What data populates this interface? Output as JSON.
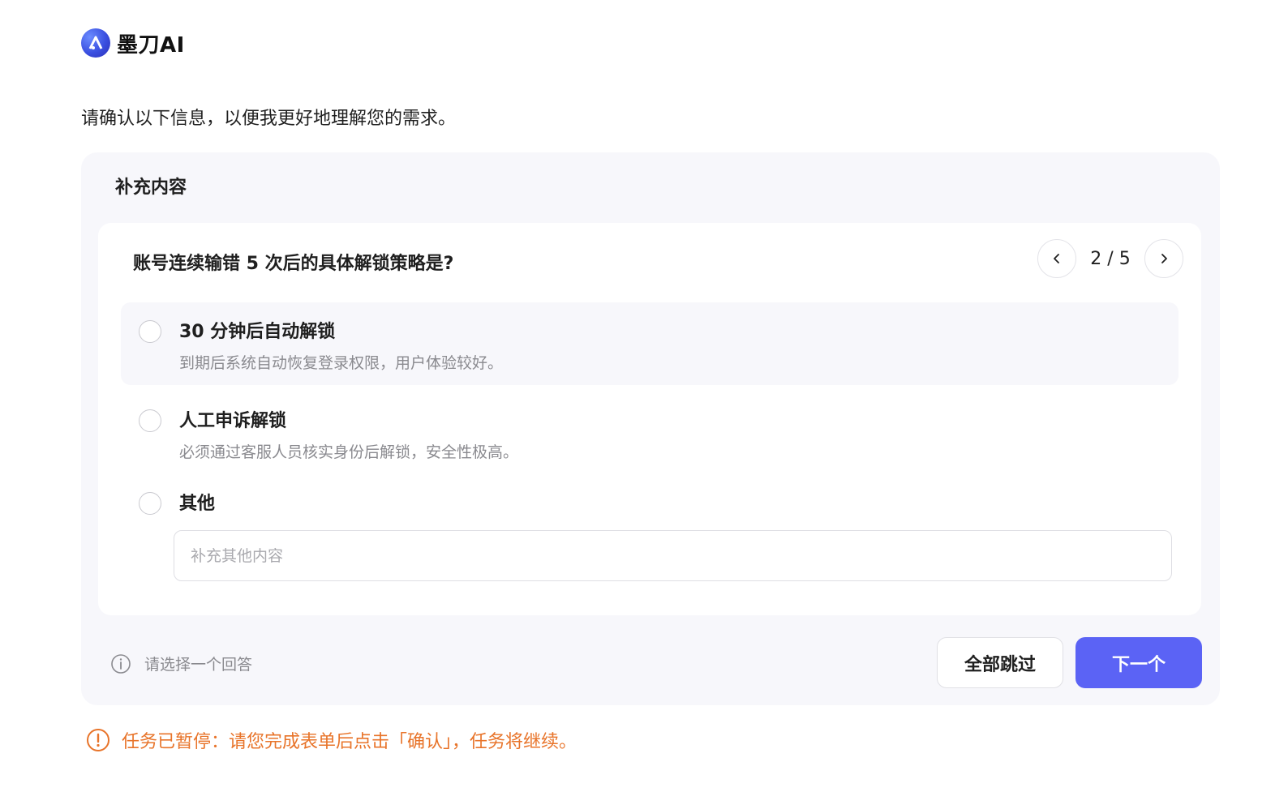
{
  "brand": {
    "name": "墨刀AI",
    "logo_icon": "brand-logo-icon"
  },
  "intro": "请确认以下信息，以便我更好地理解您的需求。",
  "panel": {
    "title": "补充内容",
    "question": "账号连续输错 5 次后的具体解锁策略是?",
    "pager": {
      "current": 2,
      "total": 5,
      "label": "2 / 5"
    },
    "options": [
      {
        "title": "30 分钟后自动解锁",
        "description": "到期后系统自动恢复登录权限，用户体验较好。",
        "selected": false
      },
      {
        "title": "人工申诉解锁",
        "description": "必须通过客服人员核实身份后解锁，安全性极高。",
        "selected": false
      },
      {
        "title": "其他",
        "selected": false
      }
    ],
    "other_input": {
      "placeholder": "补充其他内容",
      "value": ""
    },
    "hint": "请选择一个回答",
    "skip_label": "全部跳过",
    "next_label": "下一个"
  },
  "notice": "任务已暂停：请您完成表单后点击「确认」，任务将继续。",
  "colors": {
    "accent": "#5b63f5",
    "warning": "#e8742a",
    "panel_bg": "#f7f7fb"
  }
}
